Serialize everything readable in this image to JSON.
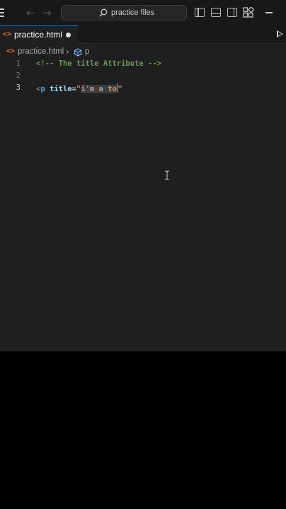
{
  "titlebar": {
    "search_text": "practice files",
    "menu_icon": "hamburger-menu-icon",
    "back_icon": "arrow-left-icon",
    "forward_icon": "arrow-right-icon",
    "layout_icons": [
      "toggle-primary-sidebar-icon",
      "toggle-panel-icon",
      "toggle-secondary-sidebar-icon",
      "customize-layout-icon"
    ],
    "minimize_icon": "minimize-icon"
  },
  "tab": {
    "label": "practice.html",
    "modified": true,
    "icon": "html-file-icon"
  },
  "run_icon": "run-icon",
  "breadcrumb": {
    "file": "practice.html",
    "separator": "›",
    "element": "p",
    "element_icon": "symbol-element-icon"
  },
  "editor": {
    "line_numbers": [
      "1",
      "2",
      "3"
    ],
    "active_line": "3",
    "line1": {
      "comment": "<!-- The title Attribute -->"
    },
    "line3": {
      "open_bracket": "<",
      "tag": "p",
      "attr": "title",
      "eq": "=",
      "quote_open": "\"",
      "value_selected": "i'm a to",
      "quote_close": "\""
    }
  },
  "colors": {
    "editor_bg": "#1f1f1f",
    "titlebar_bg": "#181818",
    "comment": "#6a9955",
    "tag": "#569cd6",
    "attr": "#9cdcfe",
    "string": "#ce9178",
    "accent": "#0078d4"
  }
}
